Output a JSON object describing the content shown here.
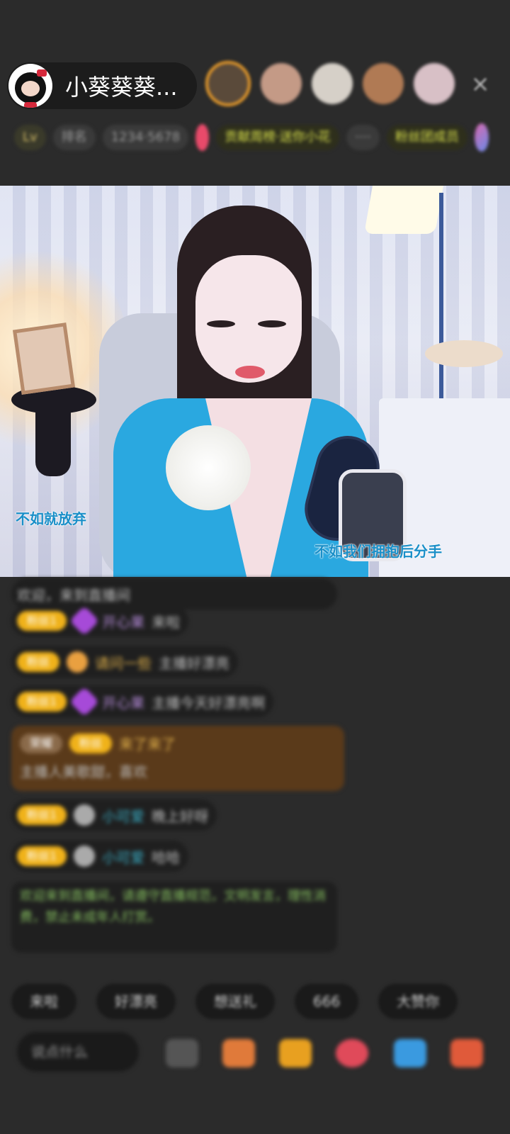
{
  "header": {
    "host_name": "小葵葵葵...",
    "viewer_count_close": "×"
  },
  "stats": {
    "chips": [
      "Lv",
      "排名",
      "1234·5678",
      "贡献周榜·送你小花",
      "····",
      "粉丝团成员"
    ]
  },
  "video": {
    "lyric_left": "不如就放弃",
    "lyric_right": "不如我们拥抱后分手"
  },
  "chat": {
    "top_line": "欢迎，来到直播间",
    "messages": [
      {
        "badge": "粉丝1",
        "user": "开心果",
        "text": "来啦"
      },
      {
        "badge": "粉丝",
        "user": "请问一些",
        "text": "主播好漂亮"
      },
      {
        "badge": "粉丝1",
        "user": "开心果",
        "text": "主播今天好漂亮啊"
      },
      {
        "badge": "粉丝1",
        "user": "小可爱",
        "text": "晚上好呀"
      },
      {
        "badge": "粉丝1",
        "user": "小可爱",
        "text": "哈哈"
      }
    ],
    "brown_message": {
      "label": "荣耀",
      "badge": "粉丝",
      "user": "来了来了",
      "text": "主播人美歌甜，喜欢"
    },
    "notice": "欢迎来到直播间，请遵守直播规范，文明发言，理性消费，禁止未成年人打赏。"
  },
  "quick_replies": [
    "来啦",
    "好漂亮",
    "想送礼",
    "666",
    "大赞你"
  ],
  "bottom": {
    "comment_placeholder": "说点什么"
  },
  "colors": {
    "background": "#2b2b2b",
    "badge_gold": "#f0b21a",
    "lyric_blue": "#1a8fc8"
  }
}
